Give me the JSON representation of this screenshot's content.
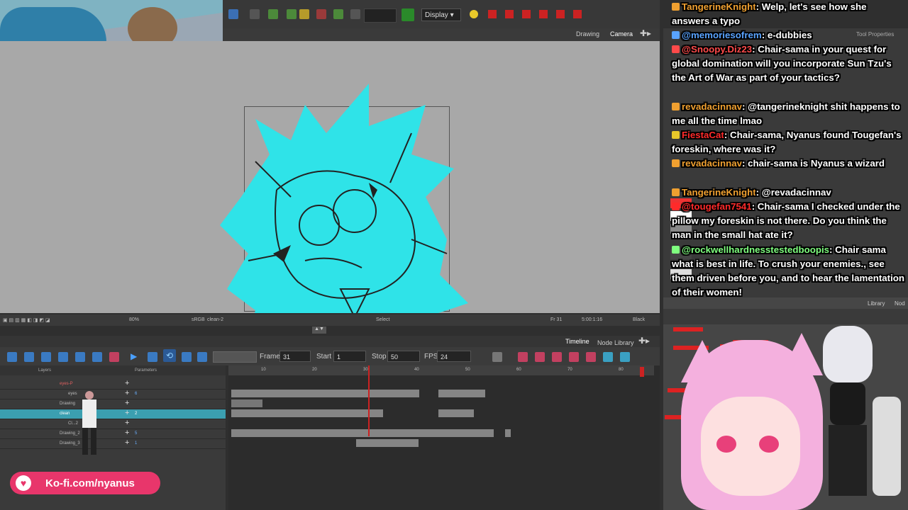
{
  "app": {
    "display_select": "Display",
    "view_tabs": [
      "Drawing",
      "Camera"
    ],
    "tool_properties": "Tool Properties",
    "library_tab": "Library",
    "node_tab": "Nod"
  },
  "view_status": {
    "zoom": "80%",
    "color_mode": "sRGB",
    "layer": "clean-2",
    "tool": "Select",
    "frame": "Fr 31",
    "timecode": "5:00:1:16",
    "bg": "Black"
  },
  "timeline": {
    "tabs": [
      "Timeline",
      "Node Library"
    ],
    "frame_label": "Frame",
    "frame_value": "31",
    "start_label": "Start",
    "start_value": "1",
    "stop_label": "Stop",
    "stop_value": "50",
    "fps_label": "FPS",
    "fps_value": "24",
    "col_layers": "Layers",
    "col_parameters": "Parameters",
    "ruler_ticks": [
      "10",
      "20",
      "30",
      "40",
      "50",
      "60",
      "70",
      "80"
    ],
    "layers": [
      {
        "name": "eyes-P",
        "num": ""
      },
      {
        "name": "eyes",
        "num": "6"
      },
      {
        "name": "Drawing",
        "num": ""
      },
      {
        "name": "clean",
        "num": "2"
      },
      {
        "name": "Cl...2",
        "num": ""
      },
      {
        "name": "Drawing_2",
        "num": "5"
      },
      {
        "name": "Drawing_3",
        "num": "1"
      }
    ]
  },
  "kofi": {
    "text": "Ko-fi.com/nyanus"
  },
  "chat": [
    {
      "user": "TangerineKnight",
      "user_color": "#f0a030",
      "msg": ": Welp, let's see how she answers a typo"
    },
    {
      "user": "@memoriesofrem",
      "user_color": "#59a3ff",
      "msg": ": e-dubbies"
    },
    {
      "user": "@Snoopy.Diz23",
      "user_color": "#ff4a4a",
      "msg": ": Chair-sama in your quest for global domination will you incorporate Sun Tzu's the Art of War as part of your tactics?"
    },
    {
      "user": "revadacinnav",
      "user_color": "#f0a030",
      "msg": ": @tangerineknight shit happens to me all the time lmao"
    },
    {
      "user": "FiestaCat",
      "user_color": "#ff2a2a",
      "msg": ": Chair-sama, Nyanus found Tougefan's foreskin, where was it?"
    },
    {
      "user": "revadacinnav",
      "user_color": "#f0a030",
      "msg": ": chair-sama is Nyanus a wizard"
    },
    {
      "user": "TangerineKnight",
      "user_color": "#f0a030",
      "msg": ": @revadacinnav"
    },
    {
      "user": "@tougefan7541",
      "user_color": "#ff2a2a",
      "msg": ": Chair-sama I checked under the pillow my foreskin is not there. Do you think the man in the small hat ate it?"
    },
    {
      "user": "@rockwellhardnesstestedboopis",
      "user_color": "#7fff7f",
      "msg": ": Chair sama what is best in life. To crush your enemies., see them driven before you, and to hear the lamentation of their women!"
    }
  ],
  "colors": {
    "accent_cyan": "#2fe3e8",
    "kofi_pink": "#e8366b",
    "playhead": "#cc2222",
    "node_red": "#dd2222"
  }
}
